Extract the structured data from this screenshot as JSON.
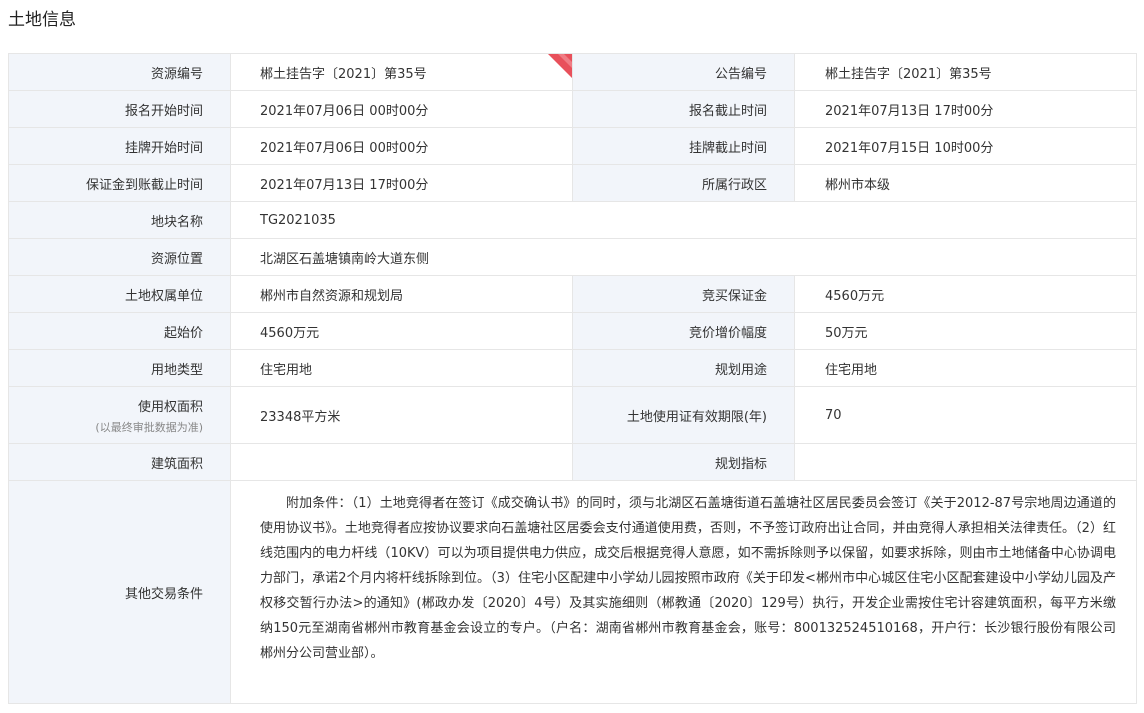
{
  "page_title": "土地信息",
  "ribbon_color": "#e8505b",
  "rows": {
    "resource_no_label": "资源编号",
    "resource_no": "郴土挂告字〔2021〕第35号",
    "notice_no_label": "公告编号",
    "notice_no": "郴土挂告字〔2021〕第35号",
    "reg_start_label": "报名开始时间",
    "reg_start": "2021年07月06日 00时00分",
    "reg_end_label": "报名截止时间",
    "reg_end": "2021年07月13日 17时00分",
    "listing_start_label": "挂牌开始时间",
    "listing_start": "2021年07月06日 00时00分",
    "listing_end_label": "挂牌截止时间",
    "listing_end": "2021年07月15日 10时00分",
    "deposit_deadline_label": "保证金到账截止时间",
    "deposit_deadline": "2021年07月13日 17时00分",
    "district_label": "所属行政区",
    "district": "郴州市本级",
    "parcel_name_label": "地块名称",
    "parcel_name": "TG2021035",
    "location_label": "资源位置",
    "location": "北湖区石盖塘镇南岭大道东侧",
    "owner_label": "土地权属单位",
    "owner": "郴州市自然资源和规划局",
    "bid_deposit_label": "竞买保证金",
    "bid_deposit": "4560万元",
    "start_price_label": "起始价",
    "start_price": "4560万元",
    "increment_label": "竞价增价幅度",
    "increment": "50万元",
    "land_type_label": "用地类型",
    "land_type": "住宅用地",
    "planning_use_label": "规划用途",
    "planning_use": "住宅用地",
    "area_label": "使用权面积",
    "area_note": "(以最终审批数据为准)",
    "area": "23348平方米",
    "cert_years_label": "土地使用证有效期限(年)",
    "cert_years": "70",
    "build_area_label": "建筑面积",
    "build_area": "",
    "planning_index_label": "规划指标",
    "planning_index": "",
    "other_conditions_label": "其他交易条件",
    "other_conditions": "附加条件：（1）土地竞得者在签订《成交确认书》的同时，须与北湖区石盖塘街道石盖塘社区居民委员会签订《关于2012-87号宗地周边通道的使用协议书》。土地竞得者应按协议要求向石盖塘社区居委会支付通道使用费，否则，不予签订政府出让合同，并由竞得人承担相关法律责任。（2）红线范围内的电力杆线（10KV）可以为项目提供电力供应，成交后根据竞得人意愿，如不需拆除则予以保留，如要求拆除，则由市土地储备中心协调电力部门，承诺2个月内将杆线拆除到位。（3）住宅小区配建中小学幼儿园按照市政府《关于印发<郴州市中心城区住宅小区配套建设中小学幼儿园及产权移交暂行办法>的通知》(郴政办发〔2020〕4号）及其实施细则（郴教通〔2020〕129号）执行，开发企业需按住宅计容建筑面积，每平方米缴纳150元至湖南省郴州市教育基金会设立的专户。（户名：湖南省郴州市教育基金会，账号：800132524510168，开户行：长沙银行股份有限公司郴州分公司营业部）。"
  }
}
